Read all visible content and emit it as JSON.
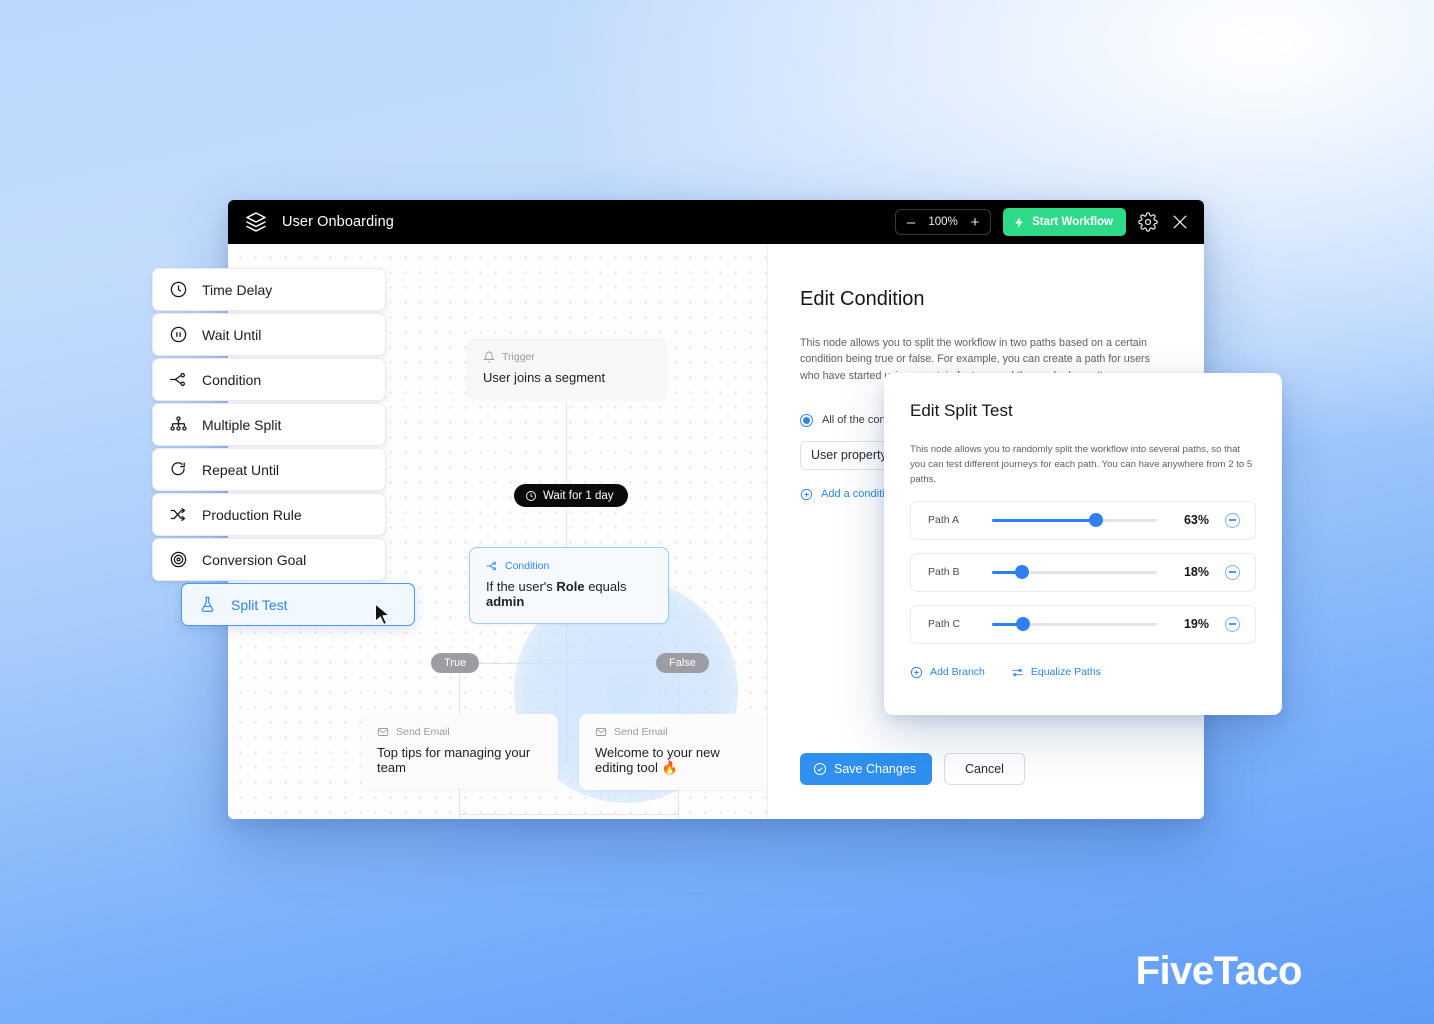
{
  "window": {
    "title": "User Onboarding",
    "logo_icon": "layers-stack-icon",
    "zoom": {
      "minus_label": "–",
      "value": "100%",
      "plus_label": "+"
    },
    "start_button": "Start Workflow",
    "settings_icon": "gear-icon",
    "close_icon": "close-icon"
  },
  "palette": {
    "items": [
      {
        "label": "Time Delay",
        "icon": "clock-icon"
      },
      {
        "label": "Wait Until",
        "icon": "pause-circle-icon"
      },
      {
        "label": "Condition",
        "icon": "branch-icon"
      },
      {
        "label": "Multiple Split",
        "icon": "org-tree-icon"
      },
      {
        "label": "Repeat Until",
        "icon": "refresh-icon"
      },
      {
        "label": "Production Rule",
        "icon": "shuffle-icon"
      },
      {
        "label": "Conversion Goal",
        "icon": "target-icon"
      },
      {
        "label": "Split Test",
        "icon": "flask-icon",
        "active": true
      }
    ]
  },
  "canvas": {
    "nodes": [
      {
        "kind": "Trigger",
        "kind_icon": "bell-icon",
        "text": "User joins a segment"
      },
      {
        "kind": "Condition",
        "kind_icon": "branch-icon",
        "text_prefix": "If the user's ",
        "text_bold1": "Role",
        "text_mid": " equals ",
        "text_bold2": "admin"
      },
      {
        "kind": "Send Email",
        "kind_icon": "envelope-icon",
        "text": "Top tips for managing your team"
      },
      {
        "kind": "Send Email",
        "kind_icon": "envelope-icon",
        "text": "Welcome to your new editing tool 🔥"
      }
    ],
    "wait_pill": {
      "label": "Wait for 1 day",
      "icon": "clock-icon"
    },
    "branch_labels": {
      "true": "True",
      "false": "False"
    },
    "cursor_icon": "mouse-cursor-icon"
  },
  "edit_condition": {
    "title": "Edit Condition",
    "description": "This node allows you to split the workflow in two paths based on a certain condition being true or false. For example, you can create a path for users who have started using a certain feature, and those who haven't.",
    "radio_label": "All of the conditi",
    "select_value": "User property",
    "select_chevron_icon": "chevron-down-icon",
    "add_condition_label": "Add a condition",
    "add_condition_icon": "plus-circle-icon",
    "save_label": "Save Changes",
    "save_icon": "check-circle-icon",
    "cancel_label": "Cancel"
  },
  "edit_split_test": {
    "title": "Edit Split Test",
    "description": "This node allows you to randomly split the workflow into several paths, so that you can test different journeys for each path. You can have anywhere from 2 to 5 paths.",
    "paths": [
      {
        "label": "Path A",
        "percent": "63%",
        "value": 63,
        "remove_icon": "minus-circle-icon"
      },
      {
        "label": "Path B",
        "percent": "18%",
        "value": 18,
        "remove_icon": "minus-circle-icon"
      },
      {
        "label": "Path C",
        "percent": "19%",
        "value": 19,
        "remove_icon": "minus-circle-icon"
      }
    ],
    "add_branch_label": "Add Branch",
    "add_branch_icon": "plus-circle-icon",
    "equalize_label": "Equalize Paths",
    "equalize_icon": "sliders-icon"
  },
  "watermark": {
    "text": "FiveTaco"
  },
  "colors": {
    "accent_blue": "#2f90f0",
    "start_green": "#2fd98a",
    "titlebar": "#000000",
    "slider_blue": "#2f7ff0",
    "background_blue": "#5d9cf8"
  }
}
